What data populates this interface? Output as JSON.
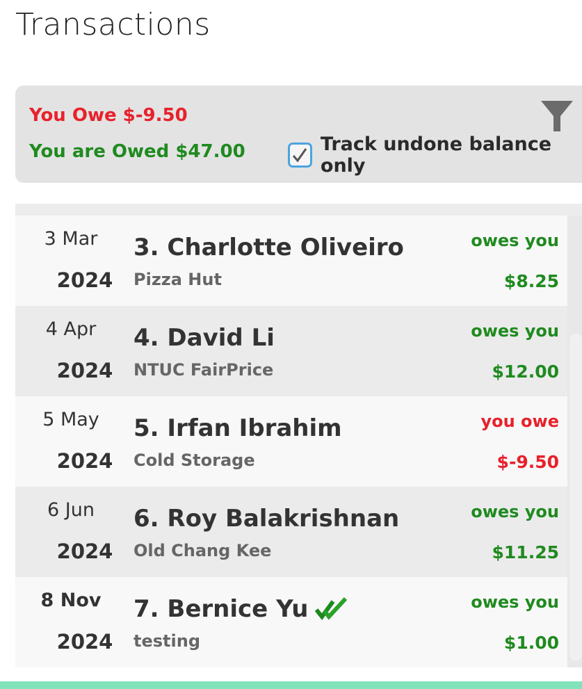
{
  "header": {
    "title": "Transactions"
  },
  "summary": {
    "you_owe_label": "You Owe $-9.50",
    "you_are_owed_label": "You are Owed $47.00",
    "track_undone_label": "Track undone balance only",
    "track_undone_checked": true,
    "filter_icon": "filter-icon"
  },
  "colors": {
    "owe_red": "#e8212b",
    "owed_green": "#1f8a1f",
    "accent_bar": "#82e3bb",
    "checkbox_border": "#4ba4e1"
  },
  "transactions": [
    {
      "date_day": "3 Mar",
      "date_year": "2024",
      "name": "3. Charlotte Oliveiro",
      "merchant": "Pizza Hut",
      "status": "owes you",
      "amount": "$8.25",
      "direction": "owed",
      "done": false
    },
    {
      "date_day": "4 Apr",
      "date_year": "2024",
      "name": "4. David Li",
      "merchant": "NTUC FairPrice",
      "status": "owes you",
      "amount": "$12.00",
      "direction": "owed",
      "done": false
    },
    {
      "date_day": "5 May",
      "date_year": "2024",
      "name": "5. Irfan Ibrahim",
      "merchant": "Cold Storage",
      "status": "you owe",
      "amount": "$-9.50",
      "direction": "owe",
      "done": false
    },
    {
      "date_day": "6 Jun",
      "date_year": "2024",
      "name": "6. Roy Balakrishnan",
      "merchant": "Old Chang Kee",
      "status": "owes you",
      "amount": "$11.25",
      "direction": "owed",
      "done": false
    },
    {
      "date_day": "8 Nov",
      "date_year": "2024",
      "name": "7. Bernice Yu",
      "merchant": "testing",
      "status": "owes you",
      "amount": "$1.00",
      "direction": "owed",
      "done": true
    }
  ]
}
